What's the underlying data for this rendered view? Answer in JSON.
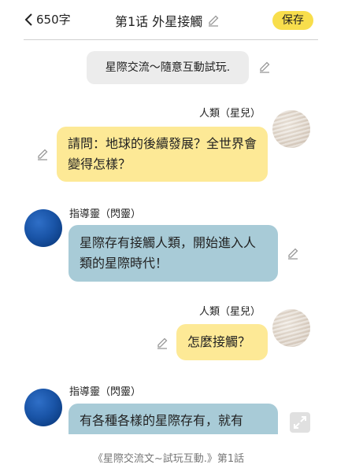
{
  "header": {
    "char_count": "650字",
    "title": "第1话 外星接觸",
    "save_label": "保存"
  },
  "scene_card": {
    "text": "星際交流～隨意互動試玩."
  },
  "messages": [
    {
      "speaker": "人類（星兒）",
      "text": "請問：地球的後續發展？全世界會變得怎樣？"
    },
    {
      "speaker": "指導靈（閃靈）",
      "text": "星際存有接觸人類，開始進入人類的星際時代！"
    },
    {
      "speaker": "人類（星兒）",
      "text": "怎麼接觸？"
    },
    {
      "speaker": "指導靈（閃靈）",
      "text": "有各種各樣的星際存有，就有"
    }
  ],
  "footer": {
    "text": "《星際交流文~試玩互動.》第1話"
  },
  "icons": {
    "back": "chevron-left-icon",
    "edit": "pencil-icon",
    "expand": "expand-icon"
  },
  "colors": {
    "save_button": "#f8de4c",
    "human_bubble": "#fde996",
    "guide_bubble": "#a8cbd7",
    "scene_card": "#ececec"
  }
}
